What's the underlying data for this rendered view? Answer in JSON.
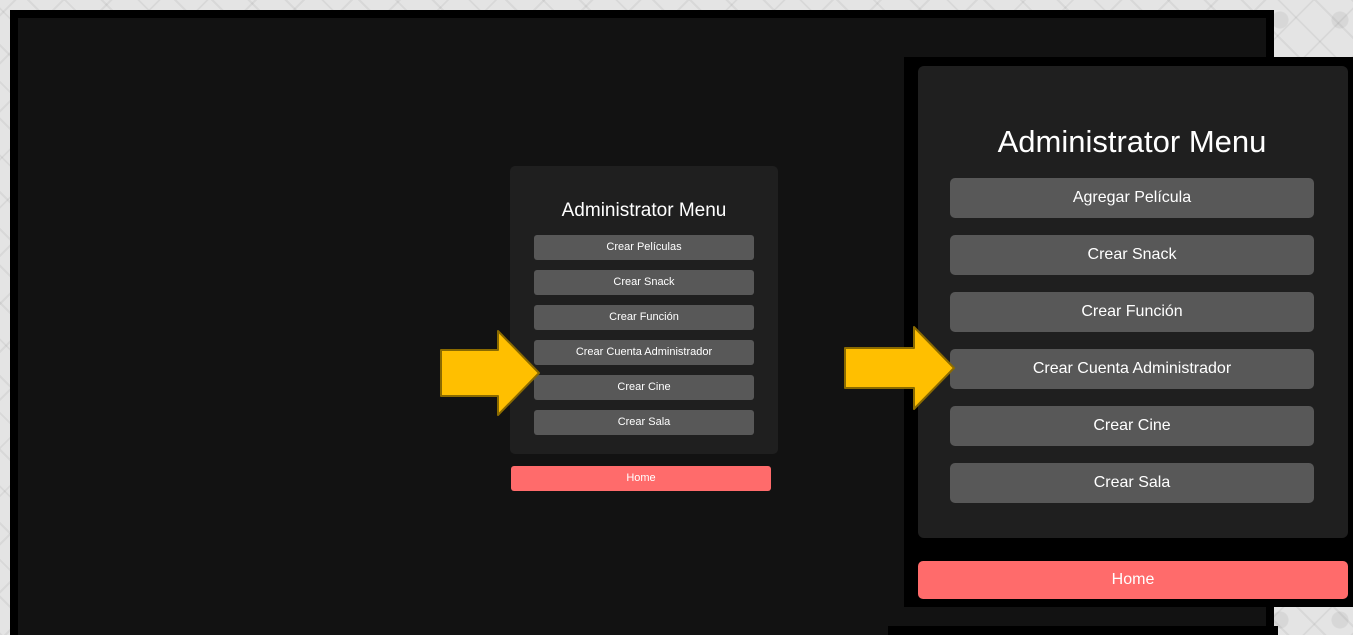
{
  "colors": {
    "page_bg": "#121212",
    "card_bg": "#1f1f1f",
    "button_bg": "#585858",
    "home_bg": "#ff6b6b",
    "arrow_fill": "#ffbf00",
    "arrow_stroke": "#8a6a00"
  },
  "small_menu": {
    "title": "Administrator Menu",
    "items": [
      {
        "label": "Crear Películas"
      },
      {
        "label": "Crear Snack"
      },
      {
        "label": "Crear Función"
      },
      {
        "label": "Crear Cuenta Administrador"
      },
      {
        "label": "Crear Cine"
      },
      {
        "label": "Crear Sala"
      }
    ],
    "home_label": "Home"
  },
  "zoom_menu": {
    "title": "Administrator Menu",
    "items": [
      {
        "label": "Agregar Película"
      },
      {
        "label": "Crear Snack"
      },
      {
        "label": "Crear Función"
      },
      {
        "label": "Crear Cuenta Administrador"
      },
      {
        "label": "Crear Cine"
      },
      {
        "label": "Crear Sala"
      }
    ],
    "home_label": "Home"
  },
  "annotations": {
    "arrow_icon": "right-arrow-icon",
    "highlighted_item": "Crear Cuenta Administrador"
  }
}
